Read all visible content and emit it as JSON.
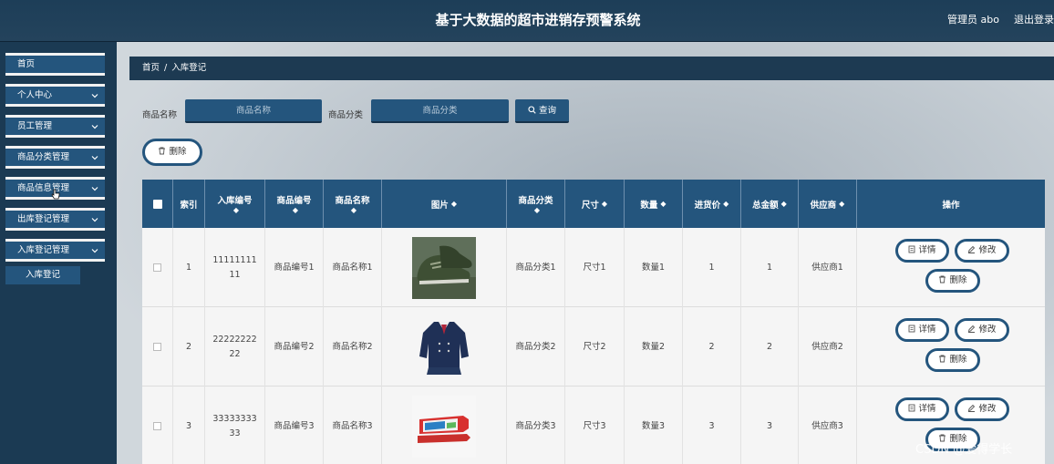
{
  "header": {
    "title": "基于大数据的超市进销存预警系统",
    "admin": "管理员 abo",
    "logout": "退出登录"
  },
  "sidebar": {
    "items": [
      {
        "label": "首页",
        "chevron": false
      },
      {
        "label": "个人中心",
        "chevron": true
      },
      {
        "label": "员工管理",
        "chevron": true
      },
      {
        "label": "商品分类管理",
        "chevron": true
      },
      {
        "label": "商品信息管理",
        "chevron": true
      },
      {
        "label": "出库登记管理",
        "chevron": true
      },
      {
        "label": "入库登记管理",
        "chevron": true
      }
    ],
    "subitem": "入库登记"
  },
  "breadcrumb": {
    "home": "首页",
    "sep": "/",
    "current": "入库登记"
  },
  "search": {
    "name_label": "商品名称",
    "name_placeholder": "商品名称",
    "category_label": "商品分类",
    "category_placeholder": "商品分类",
    "query_button": "查询"
  },
  "delete_button": "删除",
  "table": {
    "headers": [
      "索引",
      "入库编号",
      "商品编号",
      "商品名称",
      "图片",
      "商品分类",
      "尺寸",
      "数量",
      "进货价",
      "总金额",
      "供应商",
      "操作"
    ],
    "sort_mark": "◆",
    "rows": [
      {
        "index": "1",
        "in_no": "1111111111",
        "goods_no": "商品编号1",
        "goods_name": "商品名称1",
        "image": "shoes",
        "category": "商品分类1",
        "size": "尺寸1",
        "qty": "数量1",
        "price": "1",
        "total": "1",
        "supplier": "供应商1"
      },
      {
        "index": "2",
        "in_no": "2222222222",
        "goods_no": "商品编号2",
        "goods_name": "商品名称2",
        "image": "uniform",
        "category": "商品分类2",
        "size": "尺寸2",
        "qty": "数量2",
        "price": "2",
        "total": "2",
        "supplier": "供应商2"
      },
      {
        "index": "3",
        "in_no": "3333333333",
        "goods_no": "商品编号3",
        "goods_name": "商品名称3",
        "image": "toothpaste",
        "category": "商品分类3",
        "size": "尺寸3",
        "qty": "数量3",
        "price": "3",
        "total": "3",
        "supplier": "供应商3"
      }
    ],
    "actions": {
      "detail": "详情",
      "edit": "修改",
      "delete": "删除"
    }
  },
  "watermark": "CSDN @爱得学长",
  "colors": {
    "primary": "#24557d",
    "topbar": "#1d3e58",
    "sidebar": "#1b3a53"
  }
}
